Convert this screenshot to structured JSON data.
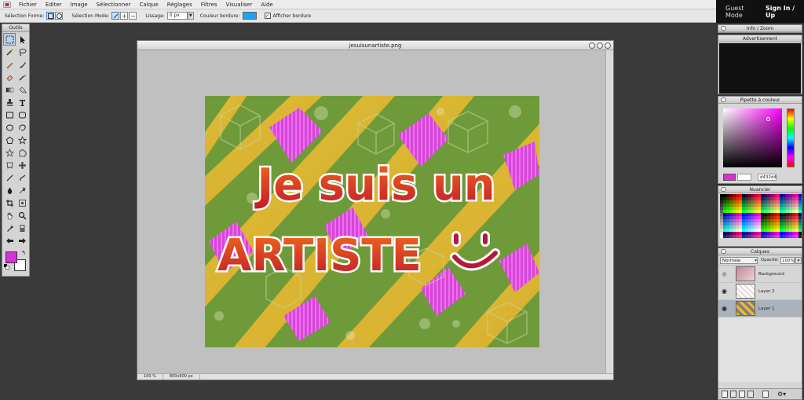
{
  "menu": {
    "items": [
      "Fichier",
      "Editer",
      "Image",
      "Sélectionner",
      "Calque",
      "Réglages",
      "Filtres",
      "Visualiser",
      "Aide"
    ]
  },
  "options": {
    "selection_forme": "Sélection Forme:",
    "selection_mode": "Sélection Mode:",
    "lissage": "Lissage:",
    "lissage_value": "0 px",
    "couleur_bordure": "Couleur bordure:",
    "afficher_bordure": "Afficher bordure",
    "border_color": "#1aa3f0"
  },
  "tools": {
    "title": "Outils",
    "fg_color": "#d432d4",
    "bg_color": "#ffffff"
  },
  "document": {
    "filename": "jesuisunartiste.png",
    "zoom": "100 %",
    "size": "800x600 px",
    "text_line1": "Je suis un",
    "text_line2": "ARTISTE"
  },
  "account": {
    "guest": "Guest Mode",
    "signin": "Sign In / Up"
  },
  "panels": {
    "info_zoom": "Info / Zoom",
    "advertisement": "Advertisement",
    "pipette": "Pipette à couleur",
    "hex_value": "d432d4",
    "nuancier": "Nuancier",
    "calques": "Calques",
    "blend_mode": "Normale",
    "opacity_label": "Opacité:",
    "opacity_value": "100%"
  },
  "layers": [
    {
      "name": "Background",
      "visible": false,
      "selected": false
    },
    {
      "name": "Layer 2",
      "visible": true,
      "selected": false
    },
    {
      "name": "Layer 1",
      "visible": true,
      "selected": true
    }
  ]
}
